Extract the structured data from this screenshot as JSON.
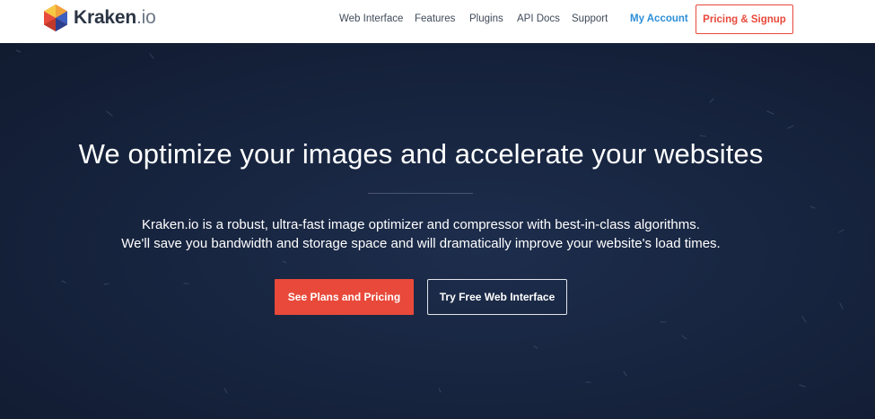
{
  "header": {
    "logo": {
      "name": "Kraken",
      "tld": ".io"
    },
    "nav": [
      "Web Interface",
      "Features",
      "Plugins",
      "API Docs",
      "Support"
    ],
    "account_label": "My Account",
    "signup_label": "Pricing & Signup"
  },
  "hero": {
    "title": "We optimize your images and accelerate your websites",
    "description_line1": "Kraken.io is a robust, ultra-fast image optimizer and compressor with best-in-class algorithms.",
    "description_line2": "We'll save you bandwidth and storage space and will dramatically improve your website's load times.",
    "primary_button": "See Plans and Pricing",
    "secondary_button": "Try Free Web Interface"
  },
  "colors": {
    "accent": "#e8493a",
    "link": "#2d8fd8",
    "hero_bg": "#16223a"
  }
}
